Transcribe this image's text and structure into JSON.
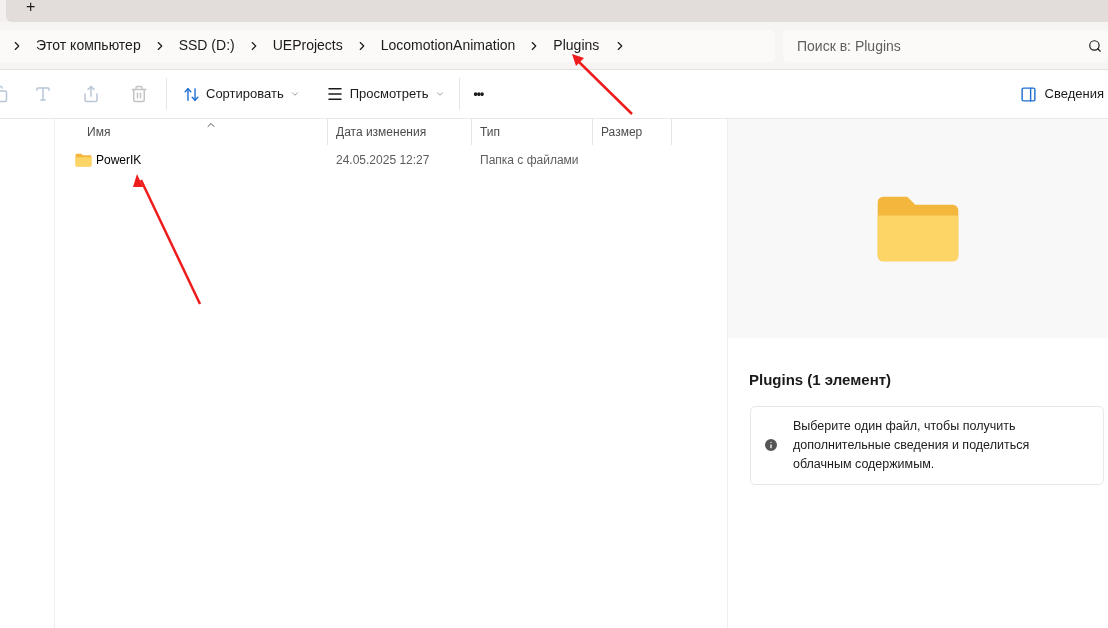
{
  "tab_strip": {
    "new_tab": "+"
  },
  "breadcrumbs": [
    "Этот компьютер",
    "SSD (D:)",
    "UEProjects",
    "LocomotionAnimation",
    "Plugins"
  ],
  "search": {
    "placeholder": "Поиск в: Plugins"
  },
  "toolbar": {
    "sort": "Сортировать",
    "view": "Просмотреть",
    "more": "•••",
    "details": "Сведения"
  },
  "table": {
    "columns": [
      {
        "label": "Имя",
        "sorted": true
      },
      {
        "label": "Дата изменения",
        "sorted": false
      },
      {
        "label": "Тип",
        "sorted": false
      },
      {
        "label": "Размер",
        "sorted": false
      }
    ],
    "rows": [
      {
        "name": "PowerIK",
        "date": "24.05.2025 12:27",
        "type": "Папка с файлами",
        "size_text": null
      }
    ]
  },
  "details_pane": {
    "title": "Plugins (1 элемент)",
    "info": "Выберите один файл, чтобы получить дополнительные сведения и поделиться облачным содержимым."
  },
  "annotations": [
    {
      "kind": "arrow"
    },
    {
      "kind": "arrow"
    }
  ]
}
